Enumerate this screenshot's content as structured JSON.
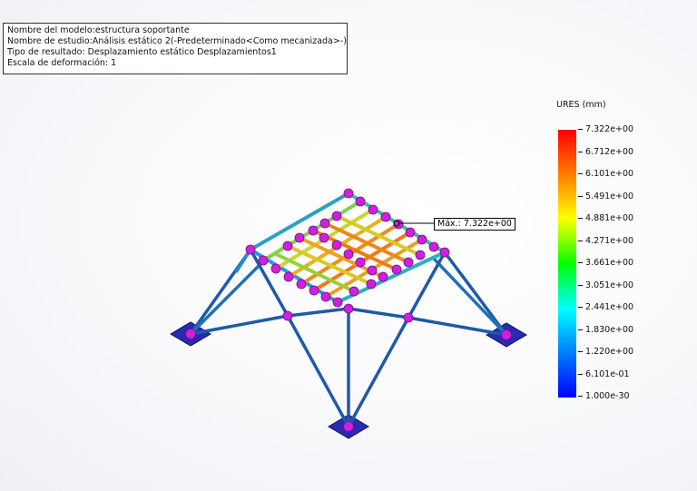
{
  "study_info": {
    "model_name": "Nombre del modelo:estructura soportante",
    "study_name": "Nombre de estudio:Análisis estático 2(-Predeterminado<Como mecanizada>-)",
    "result_type": "Tipo de resultado: Desplazamiento estático Desplazamientos1",
    "deformation_scale": "Escala de deformación: 1"
  },
  "legend": {
    "title": "URES (mm)",
    "ticks": [
      "7.322e+00",
      "6.712e+00",
      "6.101e+00",
      "5.491e+00",
      "4.881e+00",
      "4.271e+00",
      "3.661e+00",
      "3.051e+00",
      "2.441e+00",
      "1.830e+00",
      "1.220e+00",
      "6.101e-01",
      "1.000e-30"
    ],
    "colors": {
      "max": "#ff0000",
      "high": "#ffff00",
      "mid": "#00ff00",
      "low_mid": "#00ffff",
      "min": "#0000ff"
    }
  },
  "probe": {
    "max_label": "Máx.: 7.322e+00"
  },
  "colors": {
    "node": "#cc22dd",
    "support": "#2a2ab0",
    "beam": "#1e5aa8"
  }
}
